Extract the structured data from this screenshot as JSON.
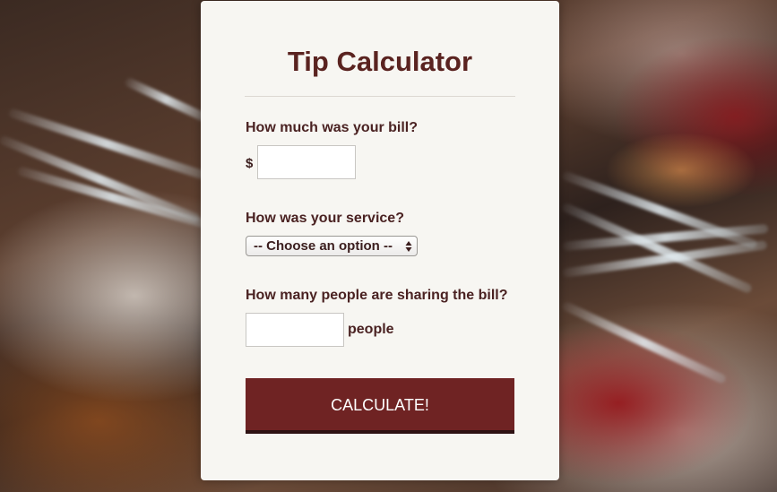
{
  "card": {
    "title": "Tip Calculator"
  },
  "bill": {
    "label": "How much was your bill?",
    "currency": "$",
    "value": ""
  },
  "service": {
    "label": "How was your service?",
    "selected": "-- Choose an option --"
  },
  "people": {
    "label": "How many people are sharing the bill?",
    "value": "",
    "suffix": "people"
  },
  "calculate": {
    "label": "CALCULATE!"
  },
  "colors": {
    "accent": "#6f2323",
    "title": "#5a2320",
    "card_bg": "#f7f6f2"
  }
}
